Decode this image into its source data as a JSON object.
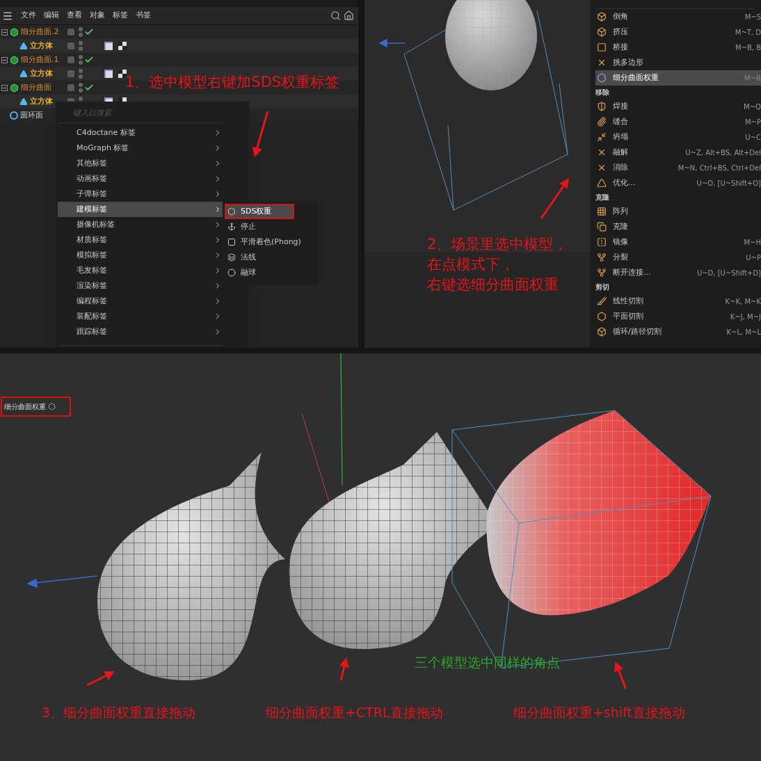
{
  "object_manager": {
    "menu": [
      "文件",
      "编辑",
      "查看",
      "对象",
      "标签",
      "书签"
    ],
    "tree": [
      {
        "name": "细分曲面.2",
        "kind": "subdivision",
        "enabled": true,
        "expanded": true,
        "children": [
          {
            "name": "立方体",
            "kind": "cube"
          }
        ]
      },
      {
        "name": "细分曲面.1",
        "kind": "subdivision",
        "enabled": true,
        "expanded": true,
        "children": [
          {
            "name": "立方体",
            "kind": "cube"
          }
        ]
      },
      {
        "name": "细分曲面",
        "kind": "subdivision",
        "enabled": true,
        "expanded": true,
        "children": [
          {
            "name": "立方体",
            "kind": "cube"
          }
        ]
      },
      {
        "name": "圆环面",
        "kind": "torus"
      }
    ]
  },
  "context_menu": {
    "placeholder": "键入以搜索",
    "items": [
      {
        "label": "C4doctane 标签",
        "selected": false
      },
      {
        "label": "MoGraph 标签",
        "selected": false
      },
      {
        "label": "其他标签",
        "selected": false
      },
      {
        "label": "动画标签",
        "selected": false
      },
      {
        "label": "子弹标签",
        "selected": false
      },
      {
        "label": "建模标签",
        "selected": true
      },
      {
        "label": "摄像机标签",
        "selected": false
      },
      {
        "label": "材质标签",
        "selected": false
      },
      {
        "label": "模拟标签",
        "selected": false
      },
      {
        "label": "毛发标签",
        "selected": false
      },
      {
        "label": "渲染标签",
        "selected": false
      },
      {
        "label": "编程标签",
        "selected": false
      },
      {
        "label": "装配标签",
        "selected": false
      },
      {
        "label": "跟踪标签",
        "selected": false
      }
    ],
    "submenu": [
      {
        "label": "SDS权重",
        "kind": "sds",
        "selected": true
      },
      {
        "label": "停止",
        "kind": "stop",
        "selected": false
      },
      {
        "label": "平滑着色(Phong)",
        "kind": "phong",
        "selected": false
      },
      {
        "label": "法线",
        "kind": "normal",
        "selected": false
      },
      {
        "label": "融球",
        "kind": "metaball",
        "selected": false
      }
    ]
  },
  "step_1": "1、选中模型右键加SDS权重标签",
  "step_2": [
    "2、场景里选中模型，",
    "在点模式下，",
    "右键选细分曲面权重"
  ],
  "tool_menu": [
    {
      "kind": "item",
      "label": "倒角",
      "shortcut": "M~S",
      "selected": false
    },
    {
      "kind": "item",
      "label": "挤压",
      "shortcut": "M~T, D",
      "selected": false
    },
    {
      "kind": "item",
      "label": "桥接",
      "shortcut": "M~B, B",
      "selected": false
    },
    {
      "kind": "item",
      "label": "挑多边形",
      "selected": false
    },
    {
      "kind": "item",
      "label": "细分曲面权重",
      "shortcut": "M~R",
      "selected": true
    },
    {
      "kind": "section",
      "label": "移除"
    },
    {
      "kind": "item",
      "label": "焊接",
      "shortcut": "M~Q",
      "selected": false
    },
    {
      "kind": "item",
      "label": "缝合",
      "shortcut": "M~P",
      "selected": false
    },
    {
      "kind": "item",
      "label": "坍塌",
      "shortcut": "U~C",
      "selected": false
    },
    {
      "kind": "item",
      "label": "融解",
      "shortcut": "U~Z, Alt+BS, Alt+Del",
      "selected": false
    },
    {
      "kind": "item",
      "label": "消除",
      "shortcut": "M~N, Ctrl+BS, Ctrl+Del",
      "selected": false
    },
    {
      "kind": "item",
      "label": "优化...",
      "shortcut": "U~O, [U~Shift+O]",
      "selected": false
    },
    {
      "kind": "section",
      "label": "克隆"
    },
    {
      "kind": "item",
      "label": "阵列",
      "selected": false
    },
    {
      "kind": "item",
      "label": "克隆",
      "selected": false
    },
    {
      "kind": "item",
      "label": "镜像",
      "shortcut": "M~H",
      "selected": false
    },
    {
      "kind": "item",
      "label": "分裂",
      "shortcut": "U~P",
      "selected": false
    },
    {
      "kind": "item",
      "label": "断开连接...",
      "shortcut": "U~D, [U~Shift+D]",
      "selected": false
    },
    {
      "kind": "section",
      "label": "剪切"
    },
    {
      "kind": "item",
      "label": "线性切割",
      "shortcut": "K~K, M~K",
      "selected": false
    },
    {
      "kind": "item",
      "label": "平面切割",
      "shortcut": "K~J, M~J",
      "selected": false
    },
    {
      "kind": "item",
      "label": "循环/路径切割",
      "shortcut": "K~L, M~L",
      "selected": false
    }
  ],
  "bottom_viewport": {
    "tag_label": "细分曲面权重",
    "note": "三个模型选中同样的角点",
    "captions": [
      "3、细分曲面权重直接拖动",
      "细分曲面权重+CTRL直接拖动",
      "细分曲面权重+shift直接拖动"
    ]
  }
}
